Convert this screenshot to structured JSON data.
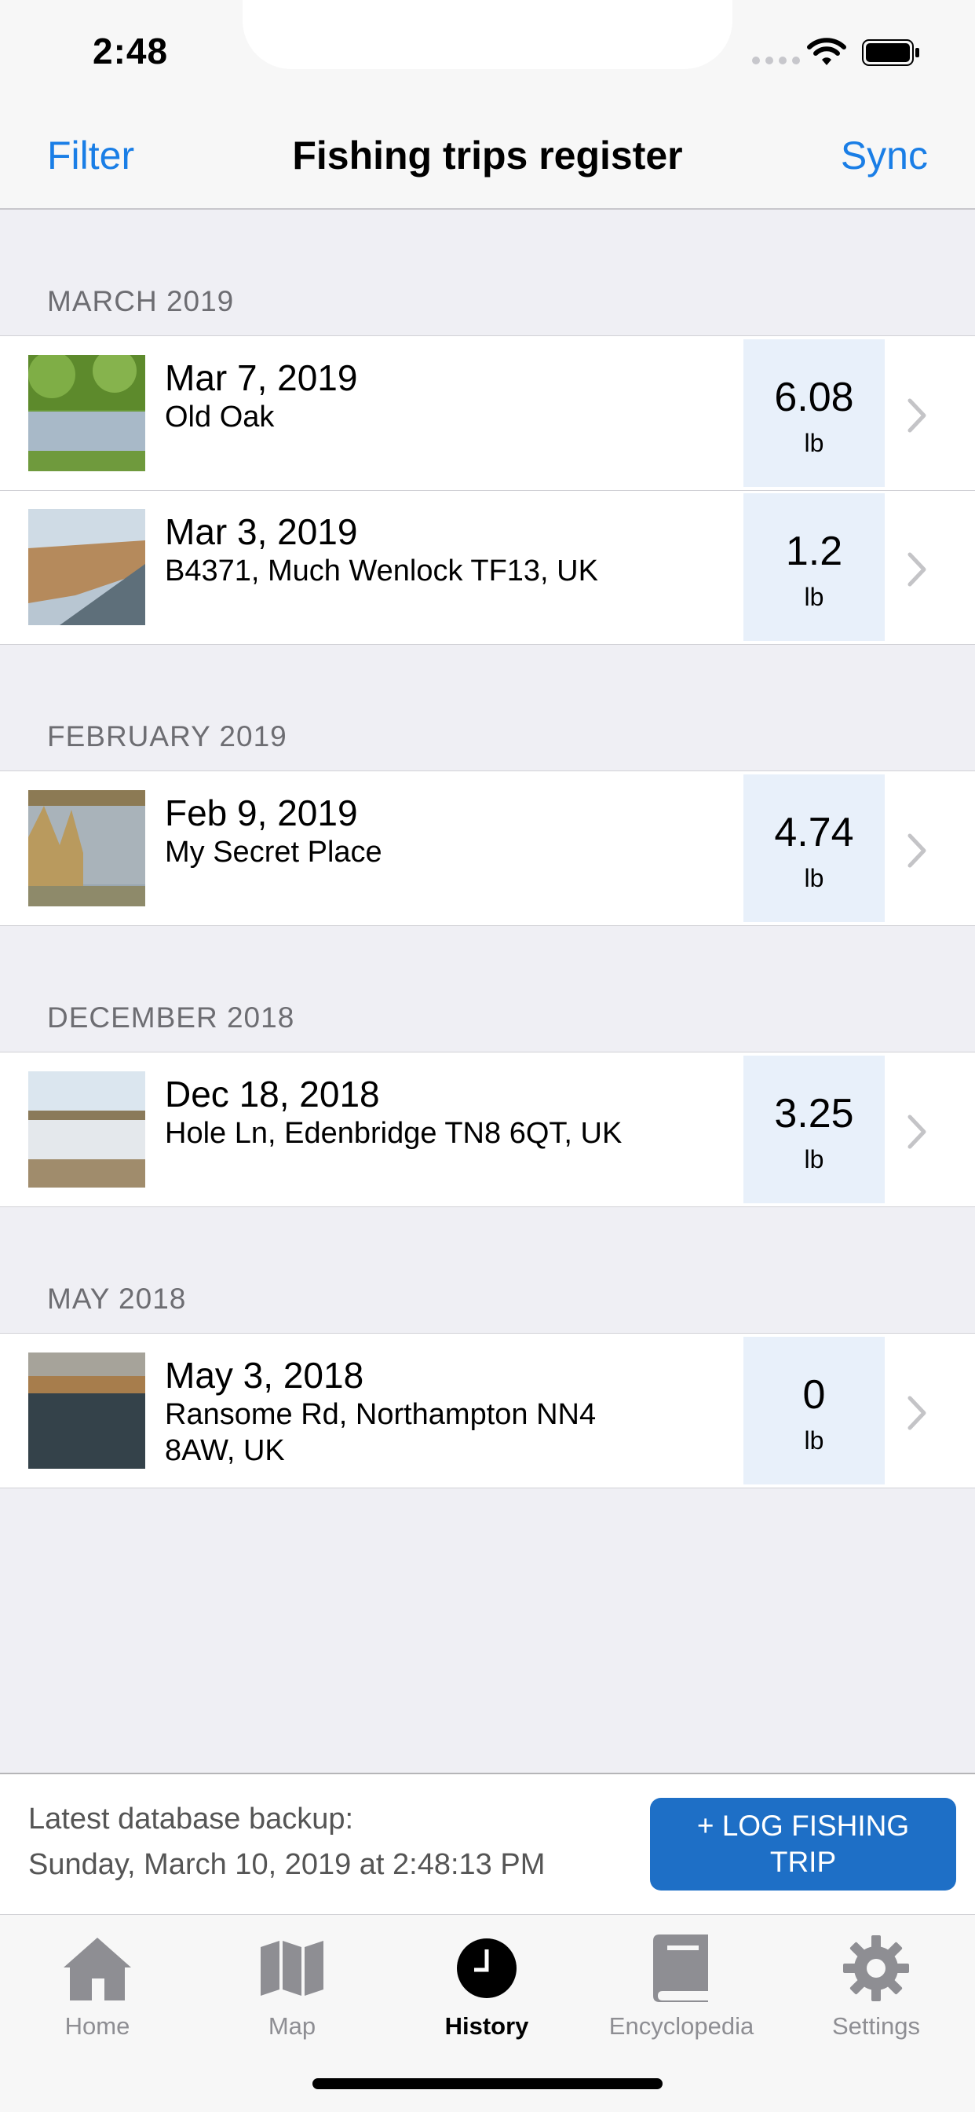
{
  "status_bar": {
    "time": "2:48"
  },
  "nav": {
    "filter": "Filter",
    "title": "Fishing trips register",
    "sync": "Sync"
  },
  "sections": [
    {
      "header": "MARCH 2019",
      "trips": [
        {
          "date": "Mar 7, 2019",
          "location": "Old Oak",
          "weight": "6.08",
          "unit": "lb"
        },
        {
          "date": "Mar 3, 2019",
          "location": "B4371, Much Wenlock TF13, UK",
          "weight": "1.2",
          "unit": "lb"
        }
      ]
    },
    {
      "header": "FEBRUARY 2019",
      "trips": [
        {
          "date": "Feb 9, 2019",
          "location": "My Secret Place",
          "weight": "4.74",
          "unit": "lb"
        }
      ]
    },
    {
      "header": "DECEMBER 2018",
      "trips": [
        {
          "date": "Dec 18, 2018",
          "location": "Hole Ln, Edenbridge TN8 6QT, UK",
          "weight": "3.25",
          "unit": "lb"
        }
      ]
    },
    {
      "header": "MAY 2018",
      "trips": [
        {
          "date": "May 3, 2018",
          "location": "Ransome Rd, Northampton NN4 8AW, UK",
          "weight": "0",
          "unit": "lb"
        }
      ]
    }
  ],
  "footer": {
    "backup_label": "Latest database backup:",
    "backup_date": "Sunday, March 10, 2019 at 2:48:13 PM",
    "log_button": "+ LOG FISHING TRIP"
  },
  "tabs": [
    {
      "label": "Home",
      "icon": "house-icon"
    },
    {
      "label": "Map",
      "icon": "map-icon"
    },
    {
      "label": "History",
      "icon": "clock-icon",
      "active": true
    },
    {
      "label": "Encyclopedia",
      "icon": "book-icon"
    },
    {
      "label": "Settings",
      "icon": "gear-icon"
    }
  ],
  "colors": {
    "accent": "#1a7ee6",
    "button": "#1e6fc6",
    "weight_bg": "#e8f0fa"
  }
}
